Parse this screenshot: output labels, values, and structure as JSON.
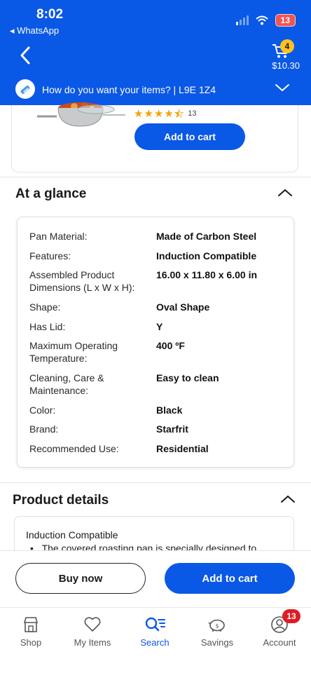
{
  "status_bar": {
    "time": "8:02",
    "back_app": "◂ WhatsApp",
    "battery": "13"
  },
  "header": {
    "cart_count": "4",
    "cart_total": "$10.30",
    "location_prompt": "How do you want your items? | L9E 1Z4"
  },
  "product": {
    "review_count": "13",
    "rating": 4.5,
    "add_to_cart_label": "Add to cart"
  },
  "at_a_glance": {
    "title": "At a glance",
    "specs": [
      {
        "label": "Pan Material:",
        "value": "Made of Carbon Steel"
      },
      {
        "label": "Features:",
        "value": "Induction Compatible"
      },
      {
        "label": "Assembled Product Dimensions (L x W x H):",
        "value": "16.00 x 11.80 x 6.00 in"
      },
      {
        "label": "Shape:",
        "value": "Oval Shape"
      },
      {
        "label": "Has Lid:",
        "value": "Y"
      },
      {
        "label": "Maximum Operating Temperature:",
        "value": "400 ºF"
      },
      {
        "label": "Cleaning, Care & Maintenance:",
        "value": "Easy to clean"
      },
      {
        "label": "Color:",
        "value": "Black"
      },
      {
        "label": "Brand:",
        "value": "Starfrit"
      },
      {
        "label": "Recommended Use:",
        "value": "Residential"
      }
    ]
  },
  "product_details": {
    "title": "Product details",
    "subtitle": "Induction Compatible",
    "bullet": "The covered roasting pan is specially designed to"
  },
  "actions": {
    "buy_now": "Buy now",
    "add_to_cart": "Add to cart"
  },
  "tabs": [
    {
      "label": "Shop"
    },
    {
      "label": "My Items"
    },
    {
      "label": "Search"
    },
    {
      "label": "Savings"
    },
    {
      "label": "Account"
    }
  ],
  "account_badge": "13",
  "colors": {
    "brand_blue": "#0a58e6",
    "star": "#f0a500",
    "badge_yellow": "#ffc220",
    "badge_red": "#de1c24"
  }
}
